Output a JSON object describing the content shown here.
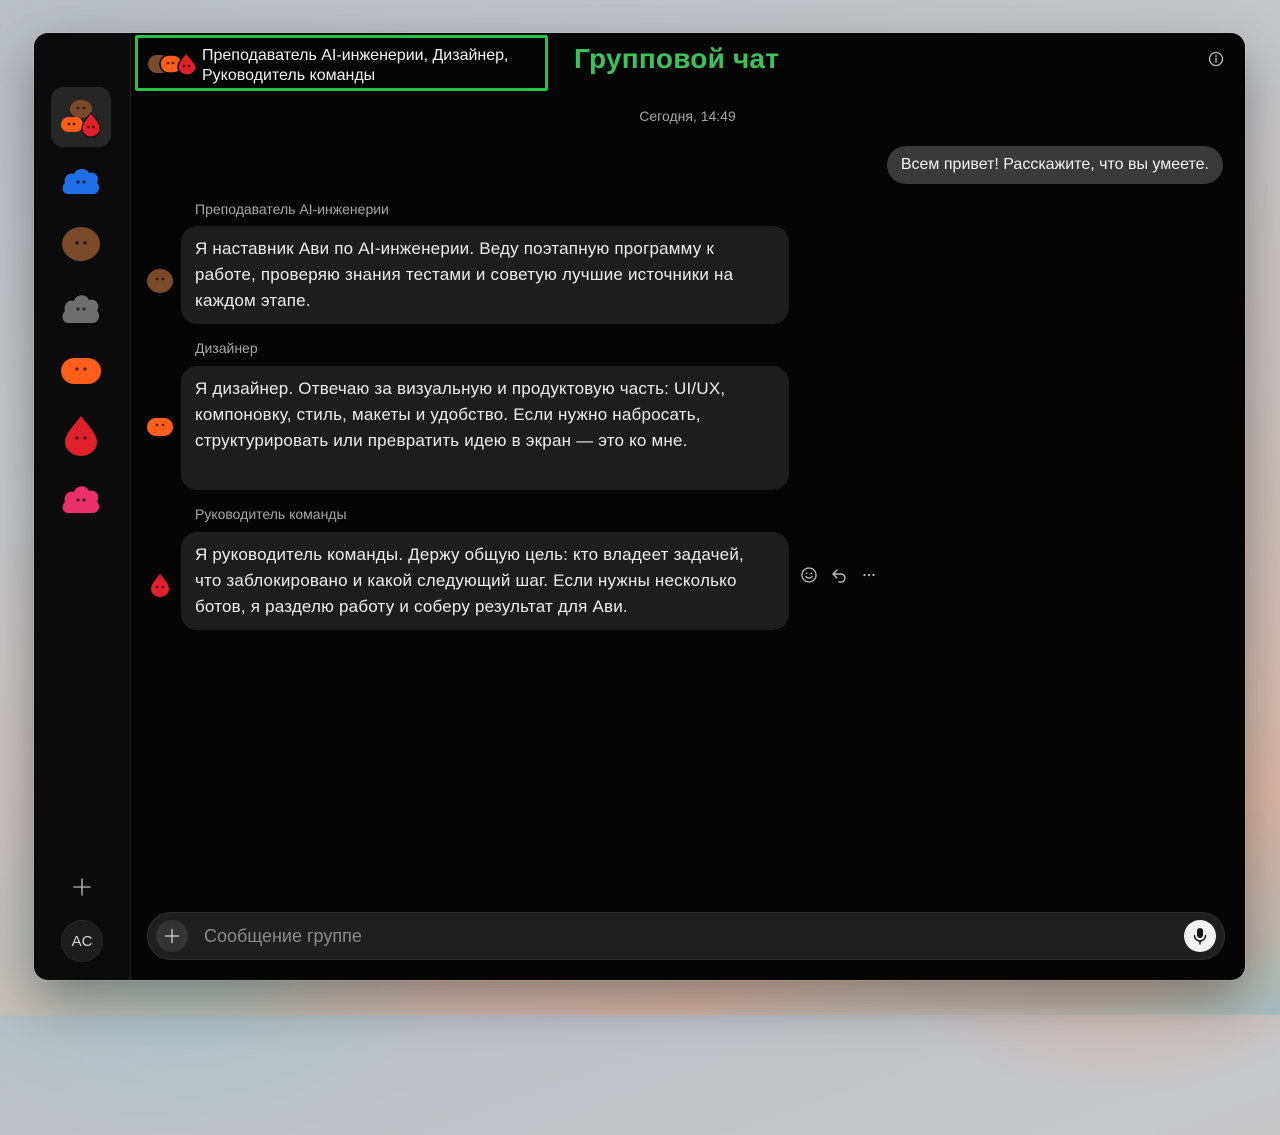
{
  "window": {
    "traffic_colors": [
      "#ff5f57",
      "#febc2e",
      "#28c840"
    ]
  },
  "sidebar": {
    "items": [
      {
        "icon": "group-avatar-icon",
        "active": true
      },
      {
        "icon": "blue-blob-icon",
        "color": "#1f6fe6"
      },
      {
        "icon": "brown-blob-icon",
        "color": "#7a4a2a"
      },
      {
        "icon": "gray-blob-icon",
        "color": "#6e6e6e"
      },
      {
        "icon": "orange-blob-icon",
        "color": "#ff5e1a"
      },
      {
        "icon": "red-drop-icon",
        "color": "#e0202b"
      },
      {
        "icon": "pink-blob-icon",
        "color": "#ea2f6a"
      }
    ],
    "add_icon": "plus-icon",
    "user_initials": "AC"
  },
  "header": {
    "participants": "Преподаватель AI-инженерии, Дизайнер, Руководитель команды",
    "title": "Групповой чат",
    "info_icon": "info-icon",
    "accent": "#3dc15a"
  },
  "chat": {
    "date_separator": "Сегодня, 14:49",
    "my_message": "Всем привет! Расскажите, что вы умеете.",
    "messages": [
      {
        "sender": "Преподаватель AI-инженерии",
        "text": "Я наставник Ави по AI-инженерии. Веду поэтапную программу к работе, проверяю знания тестами и советую лучшие источники на каждом этапе.",
        "avatar_color": "#7a4a2a"
      },
      {
        "sender": "Дизайнер",
        "text": "Я дизайнер. Отвечаю за визуальную и продуктовую часть: UI/UX, компоновку, стиль, макеты и удобство. Если нужно набросать, структурировать или превратить идею в экран — это ко мне.",
        "avatar_color": "#ff5e1a"
      },
      {
        "sender": "Руководитель команды",
        "text": "Я руководитель команды. Держу общую цель: кто владеет задачей, что заблокировано и какой следующий шаг. Если нужны несколько ботов, я разделю работу и соберу результат для Ави.",
        "avatar_color": "#e0202b"
      }
    ],
    "message_actions": [
      "emoji-icon",
      "reply-icon",
      "more-icon"
    ]
  },
  "composer": {
    "placeholder": "Сообщение группе",
    "add_icon": "plus-icon",
    "mic_icon": "microphone-icon"
  }
}
